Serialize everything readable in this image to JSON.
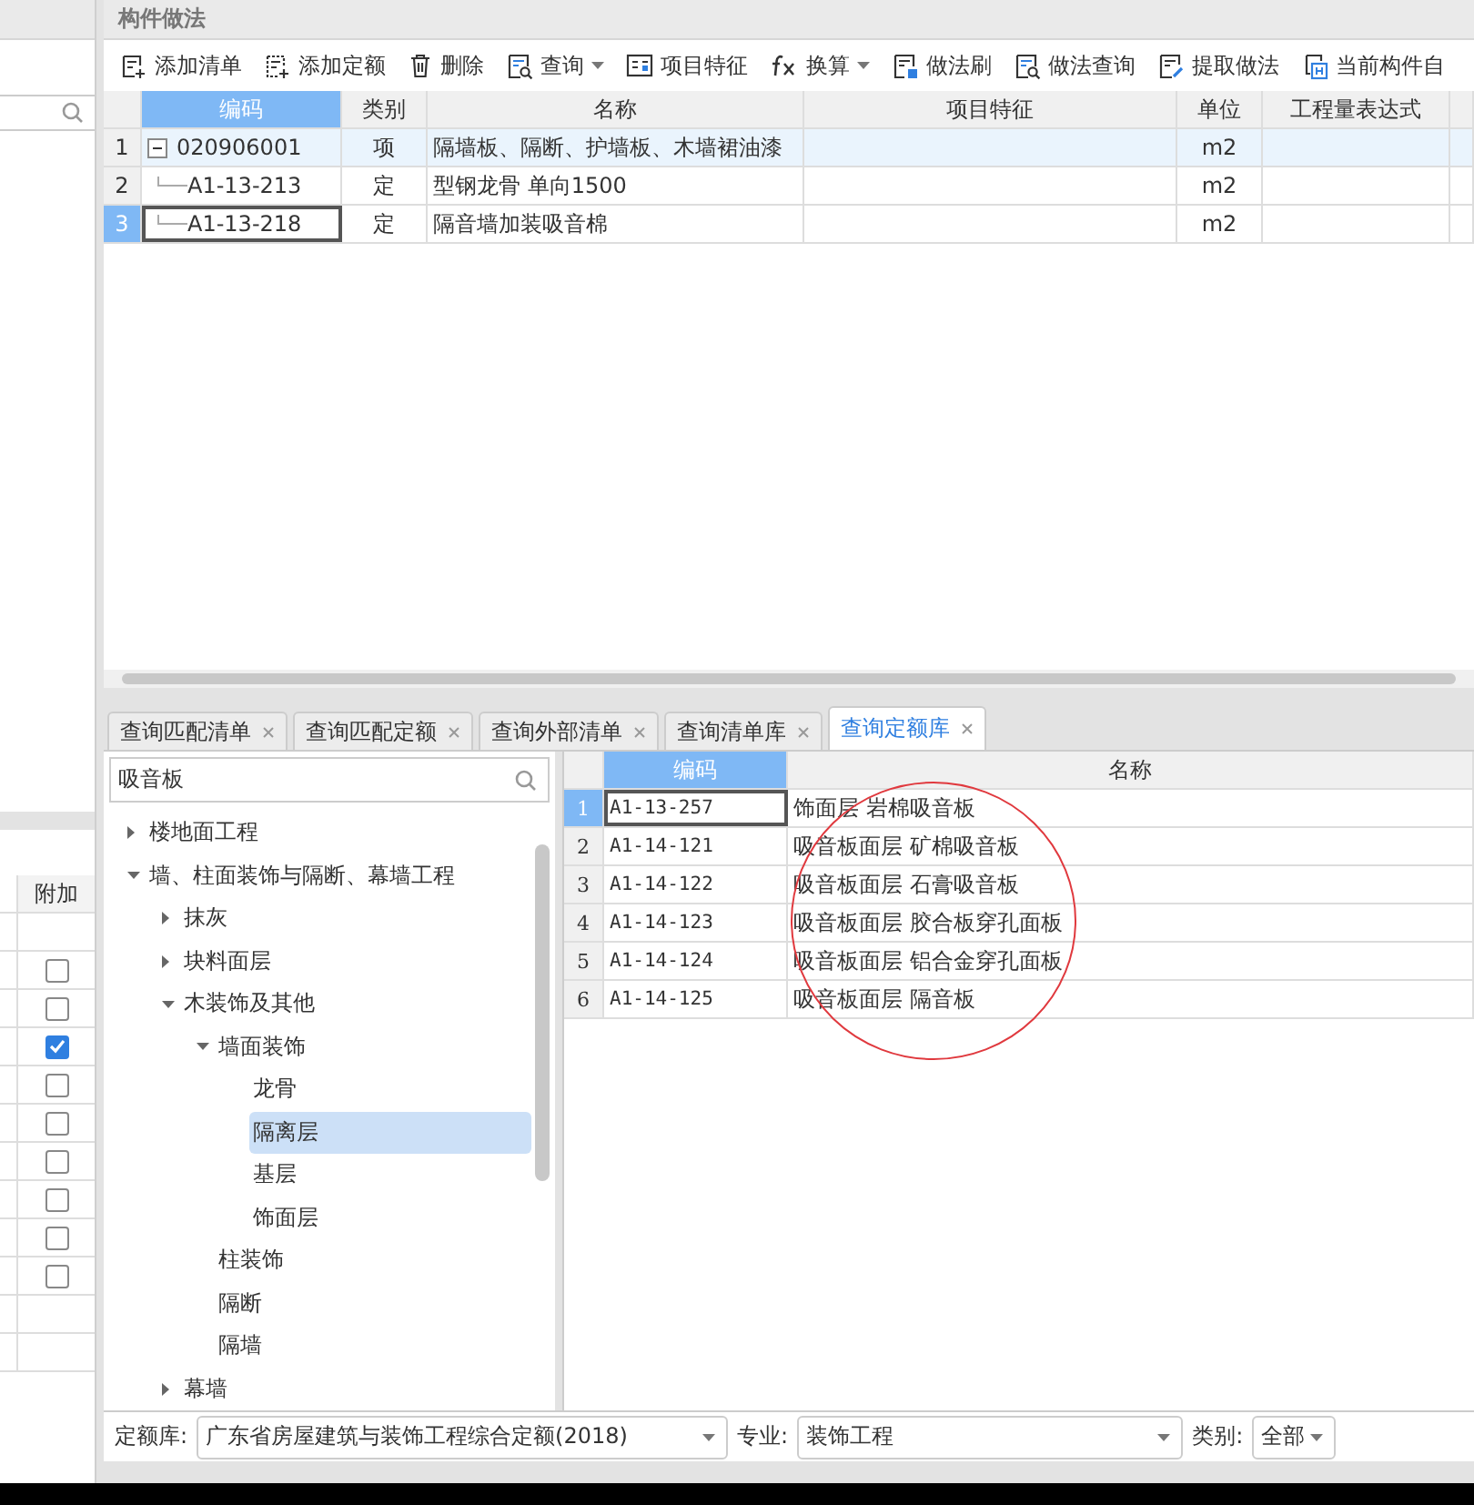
{
  "left_panel": {
    "table": {
      "columns": [
        "附加"
      ],
      "rows": [
        {
          "kind": "empty"
        },
        {
          "kind": "checkbox",
          "checked": false
        },
        {
          "kind": "checkbox",
          "checked": false
        },
        {
          "kind": "checkbox",
          "checked": true
        },
        {
          "kind": "checkbox",
          "checked": false
        },
        {
          "kind": "checkbox",
          "checked": false
        },
        {
          "kind": "checkbox",
          "checked": false
        },
        {
          "kind": "checkbox",
          "checked": false
        },
        {
          "kind": "checkbox",
          "checked": false
        },
        {
          "kind": "checkbox",
          "checked": false
        },
        {
          "kind": "empty"
        },
        {
          "kind": "empty"
        }
      ]
    }
  },
  "panel_title": "构件做法",
  "toolbar": [
    {
      "label": "添加清单",
      "dropdown": false
    },
    {
      "label": "添加定额",
      "dropdown": false
    },
    {
      "label": "删除",
      "dropdown": false
    },
    {
      "label": "查询",
      "dropdown": true
    },
    {
      "label": "项目特征",
      "dropdown": false
    },
    {
      "label": "换算",
      "dropdown": true
    },
    {
      "label": "做法刷",
      "dropdown": false
    },
    {
      "label": "做法查询",
      "dropdown": false
    },
    {
      "label": "提取做法",
      "dropdown": false
    },
    {
      "label": "当前构件自",
      "dropdown": false
    }
  ],
  "method_table": {
    "columns": [
      "编码",
      "类别",
      "名称",
      "项目特征",
      "单位",
      "工程量表达式"
    ],
    "rows": [
      {
        "num": "1",
        "code": "020906001",
        "type": "项",
        "name": "隔墙板、隔断、护墙板、木墙裙油漆",
        "unit": "m2",
        "selected": false,
        "expanded": true,
        "children": [
          {
            "num": "2",
            "code": "A1-13-213",
            "type": "定",
            "name": "型钢龙骨 单向1500",
            "unit": "m2",
            "selected": false
          },
          {
            "num": "3",
            "code": "A1-13-218",
            "type": "定",
            "name": "隔音墙加装吸音棉",
            "unit": "m2",
            "selected": true
          }
        ]
      }
    ]
  },
  "tabs": [
    {
      "label": "查询匹配清单",
      "selected": false
    },
    {
      "label": "查询匹配定额",
      "selected": false
    },
    {
      "label": "查询外部清单",
      "selected": false
    },
    {
      "label": "查询清单库",
      "selected": false
    },
    {
      "label": "查询定额库",
      "selected": true
    }
  ],
  "tree_search": {
    "value": "吸音板"
  },
  "tree": [
    {
      "label": "楼地面工程",
      "expanded": false,
      "selected": false
    },
    {
      "label": "墙、柱面装饰与隔断、幕墙工程",
      "expanded": true,
      "selected": false,
      "children": [
        {
          "label": "抹灰",
          "expanded": false,
          "selected": false
        },
        {
          "label": "块料面层",
          "expanded": false,
          "selected": false
        },
        {
          "label": "木装饰及其他",
          "expanded": true,
          "selected": false,
          "children": [
            {
              "label": "墙面装饰",
              "expanded": true,
              "selected": false,
              "children": [
                {
                  "label": "龙骨",
                  "selected": false
                },
                {
                  "label": "隔离层",
                  "selected": true
                },
                {
                  "label": "基层",
                  "selected": false
                },
                {
                  "label": "饰面层",
                  "selected": false
                }
              ]
            },
            {
              "label": "柱装饰",
              "selected": false
            },
            {
              "label": "隔断",
              "selected": false
            },
            {
              "label": "隔墙",
              "selected": false
            }
          ]
        },
        {
          "label": "幕墙",
          "expanded": false,
          "selected": false
        }
      ]
    }
  ],
  "quota_grid": {
    "columns": [
      "编码",
      "名称"
    ],
    "rows": [
      {
        "num": "1",
        "code": "A1-13-257",
        "name": "饰面层 岩棉吸音板",
        "selected": true
      },
      {
        "num": "2",
        "code": "A1-14-121",
        "name": "吸音板面层 矿棉吸音板",
        "selected": false
      },
      {
        "num": "3",
        "code": "A1-14-122",
        "name": "吸音板面层 石膏吸音板",
        "selected": false
      },
      {
        "num": "4",
        "code": "A1-14-123",
        "name": "吸音板面层 胶合板穿孔面板",
        "selected": false
      },
      {
        "num": "5",
        "code": "A1-14-124",
        "name": "吸音板面层 铝合金穿孔面板",
        "selected": false
      },
      {
        "num": "6",
        "code": "A1-14-125",
        "name": "吸音板面层 隔音板",
        "selected": false
      }
    ],
    "highlight_circle": true
  },
  "filters": [
    {
      "label": "定额库:",
      "value": "广东省房屋建筑与装饰工程综合定额(2018)"
    },
    {
      "label": "专业:",
      "value": "装饰工程"
    },
    {
      "label": "类别:",
      "value": "全部"
    }
  ]
}
